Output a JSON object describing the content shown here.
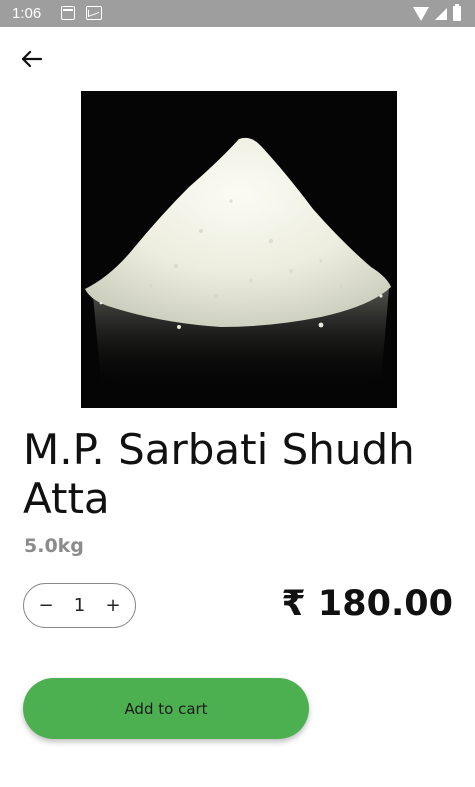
{
  "status_bar": {
    "time": "1:06"
  },
  "product": {
    "name": "M.P. Sarbati Shudh Atta",
    "weight": "5.0kg",
    "image_alt": "flour-pile-image"
  },
  "quantity": {
    "decrement_label": "−",
    "value": "1",
    "increment_label": "+"
  },
  "price": {
    "display": "₹ 180.00"
  },
  "actions": {
    "add_to_cart_label": "Add to cart"
  },
  "colors": {
    "status_bar": "#9e9e9e",
    "primary_button": "#4cb050",
    "weight_text": "#8c8c8c",
    "image_background": "#050505"
  }
}
